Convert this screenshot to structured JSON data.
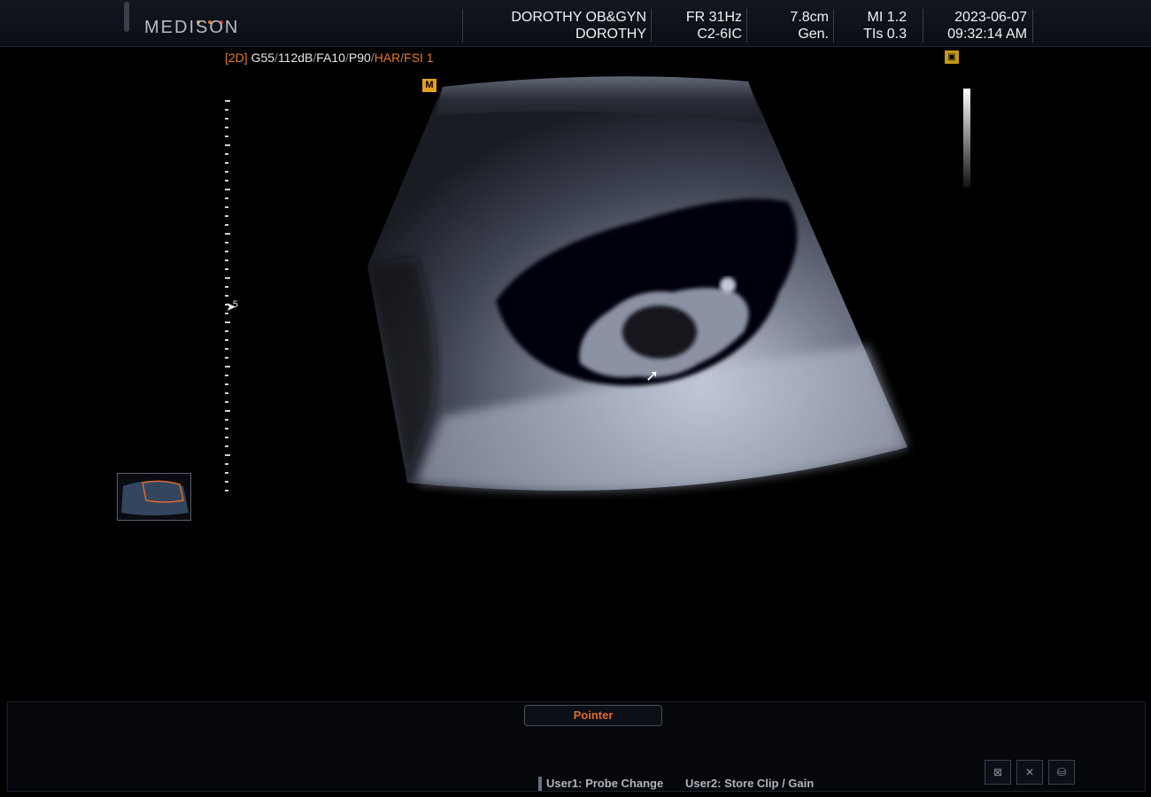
{
  "header": {
    "brand": "MEDISON",
    "brand_dot_colors": [
      "#e0a020",
      "#e07a2a",
      "#d43030"
    ],
    "institution": "DOROTHY OB&GYN",
    "operator": "DOROTHY",
    "frame_rate": "FR 31Hz",
    "probe": "C2-6IC",
    "depth": "7.8cm",
    "preset": "Gen.",
    "mi": "MI 1.2",
    "tis": "TIs 0.3",
    "date": "2023-06-07",
    "time": "09:32:14 AM"
  },
  "params": {
    "mode": "[2D]",
    "gain": "G55",
    "dynamic_range": "112dB",
    "frame_avg": "FA10",
    "power": "P90",
    "harmonic": "HAR",
    "fsi": "FSI 1",
    "sep": "/"
  },
  "markers": {
    "orientation": "M",
    "focus_label": "5"
  },
  "controls": {
    "pointer_label": "Pointer",
    "user1": "User1: Probe Change",
    "user2": "User2: Store Clip / Gain"
  },
  "tray_icons": [
    "monitor-close-icon",
    "network-close-icon",
    "storage-icon"
  ],
  "colors": {
    "accent_orange": "#e07a2a",
    "marker_yellow": "#e0a020"
  }
}
